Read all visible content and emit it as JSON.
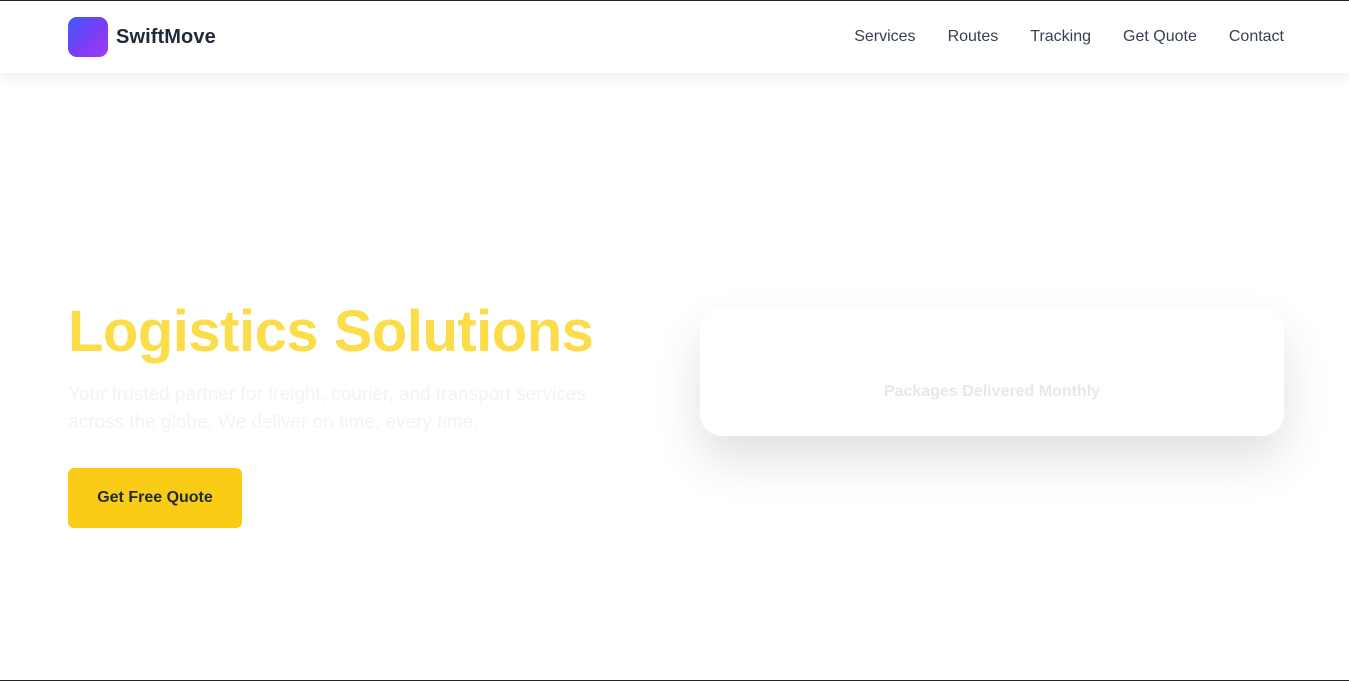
{
  "brand": {
    "name": "SwiftMove",
    "logo_icon": "gradient-square-icon",
    "logo_colors": [
      "#3b5bff",
      "#9d3cf0"
    ]
  },
  "nav": {
    "items": [
      {
        "label": "Services"
      },
      {
        "label": "Routes"
      },
      {
        "label": "Tracking"
      },
      {
        "label": "Get Quote"
      },
      {
        "label": "Contact"
      }
    ]
  },
  "hero": {
    "title": "Logistics Solutions",
    "subtitle": "Your trusted partner for freight, courier, and transport services across the globe. We deliver on time, every time.",
    "cta_label": "Get Free Quote"
  },
  "stat_card": {
    "label": "Packages Delivered Monthly"
  },
  "colors": {
    "accent": "#facc15",
    "title": "#fbdd4a",
    "text": "#1f2937"
  }
}
